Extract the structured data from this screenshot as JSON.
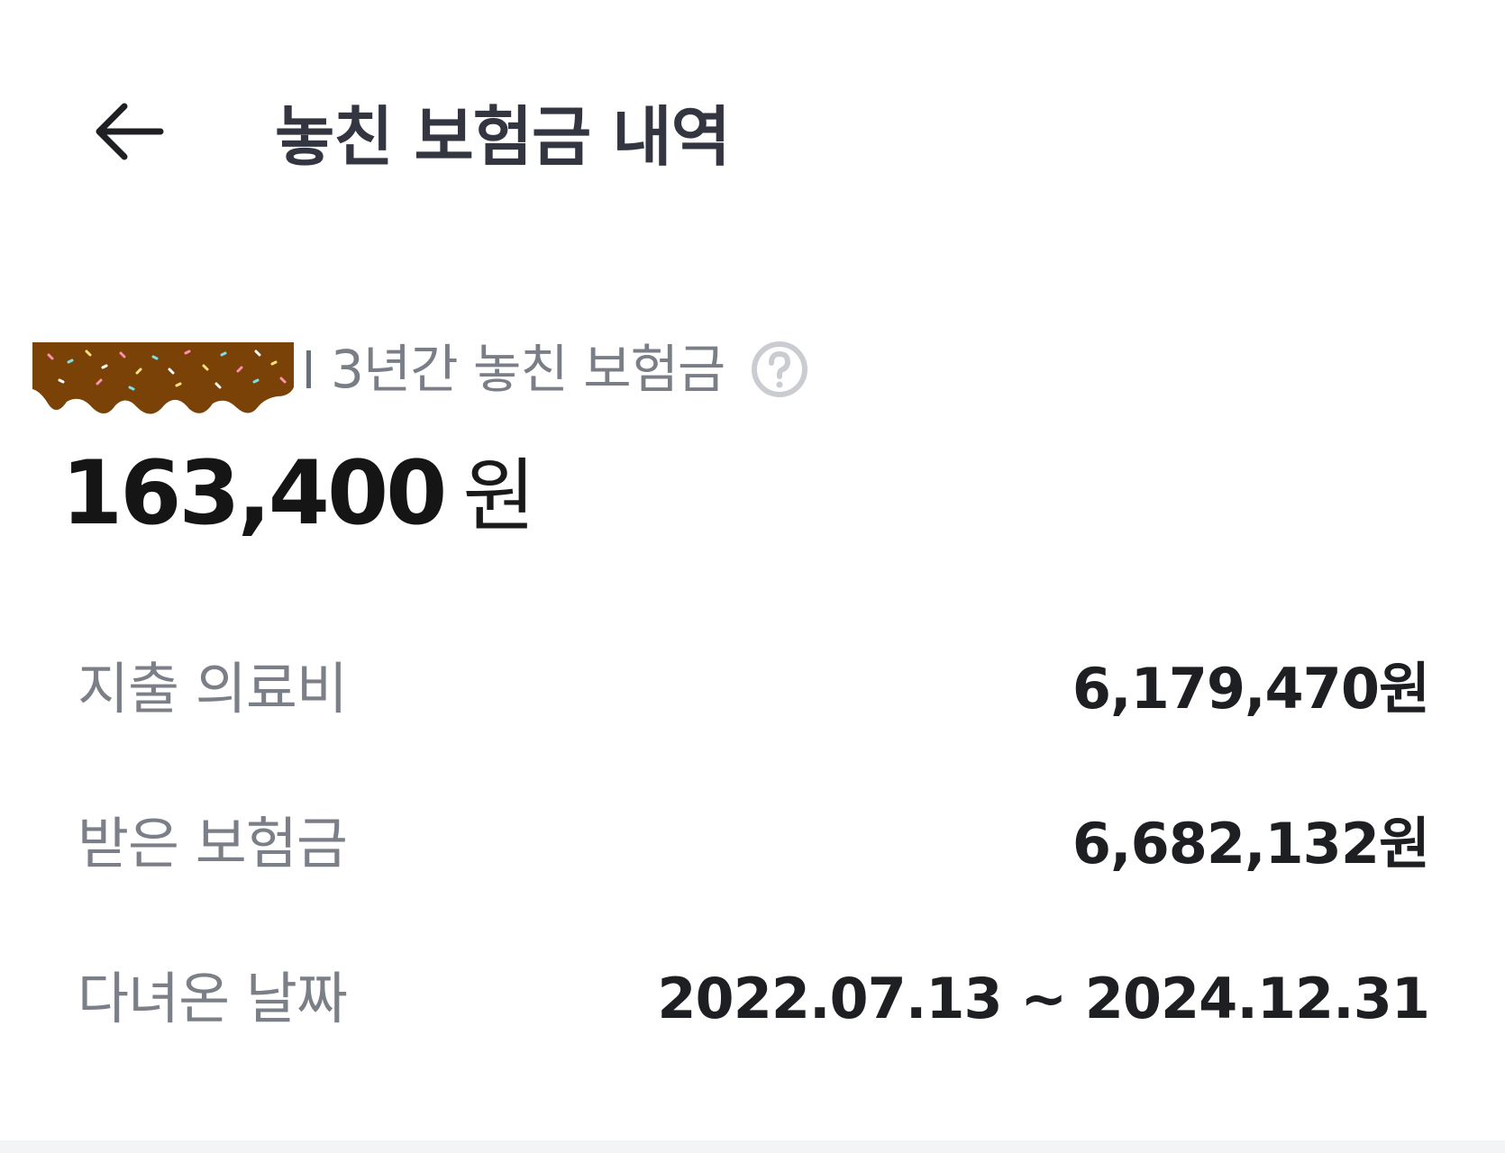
{
  "header": {
    "title": "놓친 보험금 내역",
    "back_icon": "arrow-left-icon"
  },
  "summary": {
    "subtitle": "3년간 놓친 보험금",
    "help_icon": "question-circle-icon",
    "amount_value": "163,400",
    "amount_unit": "원"
  },
  "details": [
    {
      "label": "지출 의료비",
      "value": "6,179,470원"
    },
    {
      "label": "받은 보험금",
      "value": "6,682,132원"
    },
    {
      "label": "다녀온 날짜",
      "value": "2022.07.13 ~ 2024.12.31"
    }
  ],
  "colors": {
    "title": "#333640",
    "label_gray": "#7b7f87",
    "value_dark": "#1d1f23",
    "redaction_brown": "#7a4206"
  }
}
